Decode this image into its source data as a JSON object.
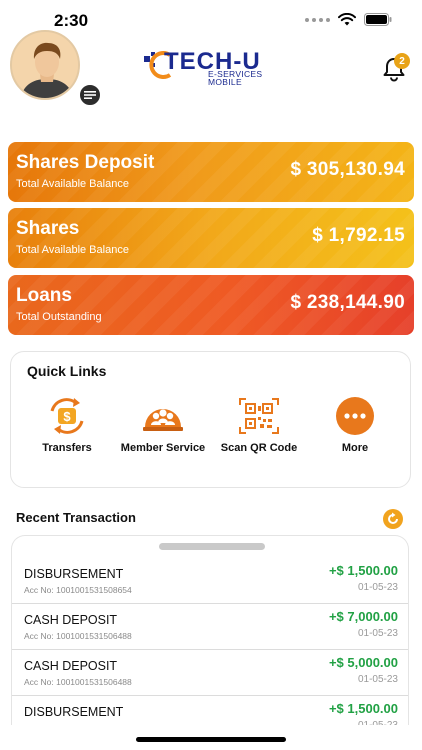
{
  "status_bar": {
    "time": "2:30"
  },
  "header": {
    "logo_main": "TECH-U",
    "logo_sub1": "E-SERVICES",
    "logo_sub2": "MOBILE",
    "notification_count": "2"
  },
  "balances": [
    {
      "title": "Shares Deposit",
      "subtitle": "Total Available Balance",
      "amount": "$ 305,130.94"
    },
    {
      "title": "Shares",
      "subtitle": "Total Available Balance",
      "amount": "$ 1,792.15"
    },
    {
      "title": "Loans",
      "subtitle": "Total Outstanding",
      "amount": "$ 238,144.90"
    }
  ],
  "quick_links": {
    "title": "Quick Links",
    "items": [
      {
        "label": "Transfers",
        "icon": "transfer-icon"
      },
      {
        "label": "Member Service",
        "icon": "member-service-icon"
      },
      {
        "label": "Scan QR Code",
        "icon": "qr-code-icon"
      },
      {
        "label": "More",
        "icon": "more-icon"
      }
    ]
  },
  "recent": {
    "title": "Recent Transaction",
    "transactions": [
      {
        "type": "DISBURSEMENT",
        "acc": "Acc No: 1001001531508654",
        "amount": "+$ 1,500.00",
        "date": "01-05-23"
      },
      {
        "type": "CASH DEPOSIT",
        "acc": "Acc No: 1001001531506488",
        "amount": "+$ 7,000.00",
        "date": "01-05-23"
      },
      {
        "type": "CASH DEPOSIT",
        "acc": "Acc No: 1001001531506488",
        "amount": "+$ 5,000.00",
        "date": "01-05-23"
      },
      {
        "type": "DISBURSEMENT",
        "acc": "",
        "amount": "+$ 1,500.00",
        "date": "01-05-23"
      }
    ]
  },
  "colors": {
    "accent_orange": "#f1a31e",
    "positive_green": "#21a144",
    "logo_blue": "#1b2a8f"
  }
}
